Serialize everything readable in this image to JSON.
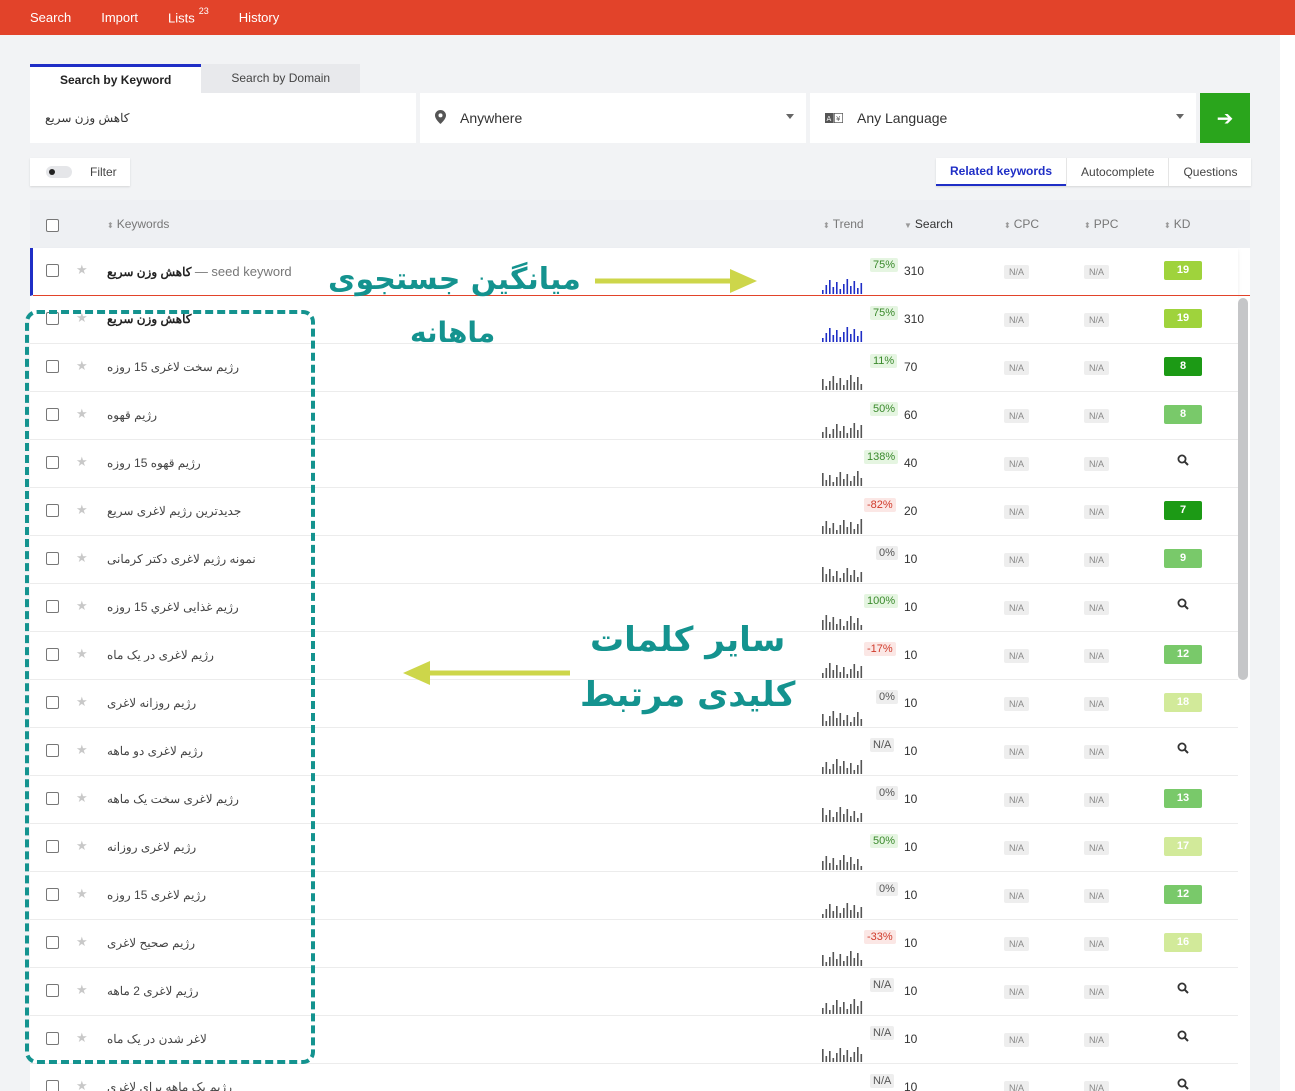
{
  "nav": {
    "search": "Search",
    "import": "Import",
    "lists": "Lists",
    "lists_count": "23",
    "history": "History"
  },
  "mode_tabs": [
    "Search by Keyword",
    "Search by Domain"
  ],
  "search": {
    "keyword": "کاهش وزن سریع",
    "location": "Anywhere",
    "language": "Any Language"
  },
  "filter": {
    "label": "Filter"
  },
  "result_tabs": [
    "Related keywords",
    "Autocomplete",
    "Questions"
  ],
  "columns": {
    "keywords": "Keywords",
    "trend": "Trend",
    "search": "Search",
    "cpc": "CPC",
    "ppc": "PPC",
    "kd": "KD"
  },
  "seed": {
    "keyword": "کاهش وزن سریع",
    "suffix": "— seed keyword",
    "trend": "75%",
    "search": "310",
    "cpc": "N/A",
    "ppc": "N/A",
    "kd": "19"
  },
  "rows": [
    {
      "keyword": "کاهش وزن سریع",
      "trend": "75%",
      "search": "310",
      "cpc": "N/A",
      "ppc": "N/A",
      "kd": "19",
      "bold": true,
      "kd_color": "#9fd33c"
    },
    {
      "keyword": "رژیم سخت لاغری 15 روزه",
      "trend": "11%",
      "search": "70",
      "cpc": "N/A",
      "ppc": "N/A",
      "kd": "8",
      "kd_color": "#1c9a15"
    },
    {
      "keyword": "رژیم قهوه",
      "trend": "50%",
      "search": "60",
      "cpc": "N/A",
      "ppc": "N/A",
      "kd": "8",
      "kd_color": "#79c96a"
    },
    {
      "keyword": "رژیم قهوه 15 روزه",
      "trend": "138%",
      "search": "40",
      "cpc": "N/A",
      "ppc": "N/A",
      "kd": "",
      "kd_color": ""
    },
    {
      "keyword": "جدیدترین رژیم لاغری سریع",
      "trend": "-82%",
      "search": "20",
      "cpc": "N/A",
      "ppc": "N/A",
      "kd": "7",
      "kd_color": "#1c9a15"
    },
    {
      "keyword": "نمونه رژیم لاغری دکتر کرمانی",
      "trend": "0%",
      "search": "10",
      "cpc": "N/A",
      "ppc": "N/A",
      "kd": "9",
      "kd_color": "#79c96a"
    },
    {
      "keyword": "رژیم غذایی لاغري 15 روزه",
      "trend": "100%",
      "search": "10",
      "cpc": "N/A",
      "ppc": "N/A",
      "kd": "",
      "kd_color": ""
    },
    {
      "keyword": "رژیم لاغری در یک ماه",
      "trend": "-17%",
      "search": "10",
      "cpc": "N/A",
      "ppc": "N/A",
      "kd": "12",
      "kd_color": "#79c96a"
    },
    {
      "keyword": "رژیم روزانه لاغری",
      "trend": "0%",
      "search": "10",
      "cpc": "N/A",
      "ppc": "N/A",
      "kd": "18",
      "kd_color": "#d2ea9a"
    },
    {
      "keyword": "رژیم لاغری دو ماهه",
      "trend": "N/A",
      "search": "10",
      "cpc": "N/A",
      "ppc": "N/A",
      "kd": "",
      "kd_color": ""
    },
    {
      "keyword": "رژیم لاغری سخت یک ماهه",
      "trend": "0%",
      "search": "10",
      "cpc": "N/A",
      "ppc": "N/A",
      "kd": "13",
      "kd_color": "#79c96a"
    },
    {
      "keyword": "رژیم لاغری روزانه",
      "trend": "50%",
      "search": "10",
      "cpc": "N/A",
      "ppc": "N/A",
      "kd": "17",
      "kd_color": "#d2ea9a"
    },
    {
      "keyword": "رژیم لاغری 15 روزه",
      "trend": "0%",
      "search": "10",
      "cpc": "N/A",
      "ppc": "N/A",
      "kd": "12",
      "kd_color": "#79c96a"
    },
    {
      "keyword": "رژیم صحیح لاغری",
      "trend": "-33%",
      "search": "10",
      "cpc": "N/A",
      "ppc": "N/A",
      "kd": "16",
      "kd_color": "#d2ea9a"
    },
    {
      "keyword": "رژیم لاغری 2 ماهه",
      "trend": "N/A",
      "search": "10",
      "cpc": "N/A",
      "ppc": "N/A",
      "kd": "",
      "kd_color": ""
    },
    {
      "keyword": "لاغر شدن در یک ماه",
      "trend": "N/A",
      "search": "10",
      "cpc": "N/A",
      "ppc": "N/A",
      "kd": "",
      "kd_color": ""
    },
    {
      "keyword": "رژیم یک ماهه برای لاغری",
      "trend": "N/A",
      "search": "10",
      "cpc": "N/A",
      "ppc": "N/A",
      "kd": "",
      "kd_color": ""
    }
  ],
  "annotations": {
    "monthly_line1": "میانگین جستجوی",
    "monthly_line2": "ماهانه",
    "related_line1": "سایر کلمات",
    "related_line2": "کلیدی مرتبط"
  },
  "colors": {
    "topbar": "#e2432a",
    "accent": "#1f2ec6",
    "go": "#2aa51c",
    "annotation": "#14938f",
    "arrow": "#cdd64a"
  }
}
